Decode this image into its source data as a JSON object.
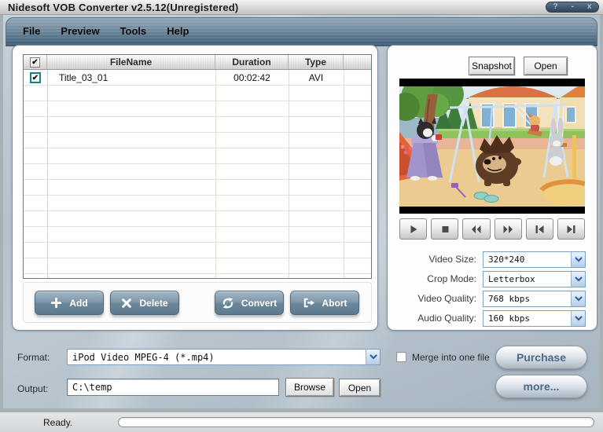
{
  "window": {
    "title": "Nidesoft VOB Converter v2.5.12(Unregistered)",
    "controls": {
      "help": "?",
      "minimize": "-",
      "close": "x"
    }
  },
  "menu": {
    "items": [
      "File",
      "Preview",
      "Tools",
      "Help"
    ]
  },
  "file_list": {
    "columns": {
      "filename": "FileName",
      "duration": "Duration",
      "type": "Type"
    },
    "header_checkbox_checked": true,
    "rows": [
      {
        "checked": true,
        "filename": "Title_03_01",
        "duration": "00:02:42",
        "type": "AVI"
      }
    ]
  },
  "actions": {
    "add": "Add",
    "delete": "Delete",
    "convert": "Convert",
    "abort": "Abort"
  },
  "preview": {
    "snapshot": "Snapshot",
    "open": "Open"
  },
  "settings": [
    {
      "label": "Video Size:",
      "value": "320*240"
    },
    {
      "label": "Crop Mode:",
      "value": "Letterbox"
    },
    {
      "label": "Video Quality:",
      "value": "768 kbps"
    },
    {
      "label": "Audio Quality:",
      "value": "160 kbps"
    }
  ],
  "output_bar": {
    "format_label": "Format:",
    "format_value": "iPod Video MPEG-4 (*.mp4)",
    "merge_checked": false,
    "merge_label": "Merge into one file",
    "purchase": "Purchase",
    "more": "more...",
    "output_label": "Output:",
    "output_value": "C:\\temp",
    "browse": "Browse",
    "open": "Open"
  },
  "status": {
    "text": "Ready."
  },
  "icons": {
    "check": "✔"
  },
  "colors": {
    "accent_button": "#6b8699",
    "menu_bar": "#58758c",
    "combo_border": "#7ba0c0",
    "teal_checkbox": "#0e8585",
    "pill_text": "#4d6a84"
  }
}
